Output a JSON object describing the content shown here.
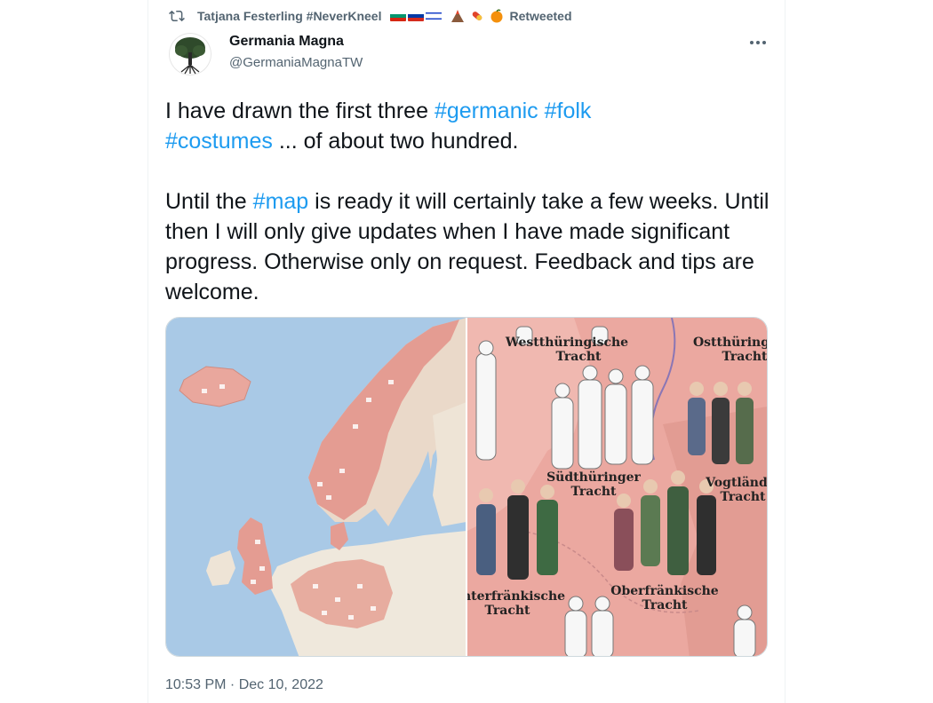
{
  "retweet": {
    "retweeter": "Tatjana Festerling #NeverKneel",
    "label": "Retweeted",
    "icon": "retweet-icon"
  },
  "author": {
    "name": "Germania Magna",
    "handle": "@GermaniaMagnaTW",
    "avatar": "tree-icon"
  },
  "tweet": {
    "line1_a": "I have drawn the first three ",
    "tag_germanic": "#germanic",
    "tag_folk": "#folk",
    "tag_costumes": "#costumes",
    "line2_b": " ... of about two hundred.",
    "para2_a": "Until the ",
    "tag_map": "#map",
    "para2_b": " is ready it will certainly take a few weeks. Until then I will only give updates when I have made significant progress. Otherwise only on request. Feedback and tips are welcome."
  },
  "media": {
    "costume_labels": {
      "westthueringische_1": "Westthüringische",
      "westthueringische_2": "Tracht",
      "ostthueringische_1": "Ostthüring",
      "ostthueringische_2": "Tracht",
      "suedthueringer_1": "Südthüringer",
      "suedthueringer_2": "Tracht",
      "vogtlaend_1": "Vogtländ",
      "vogtlaend_2": "Tracht",
      "unterfraenkische_1": "nterfränkische",
      "unterfraenkische_2": "Tracht",
      "oberfraenkische_1": "Oberfränkische",
      "oberfraenkische_2": "Tracht"
    }
  },
  "timestamp": "10:53 PM · Dec 10, 2022",
  "colors": {
    "accent": "#1d9bf0",
    "secondary_text": "#536471",
    "sea": "#a9c9e6",
    "map_land": "#efe8dc",
    "costume_area": "#eba8a0"
  }
}
